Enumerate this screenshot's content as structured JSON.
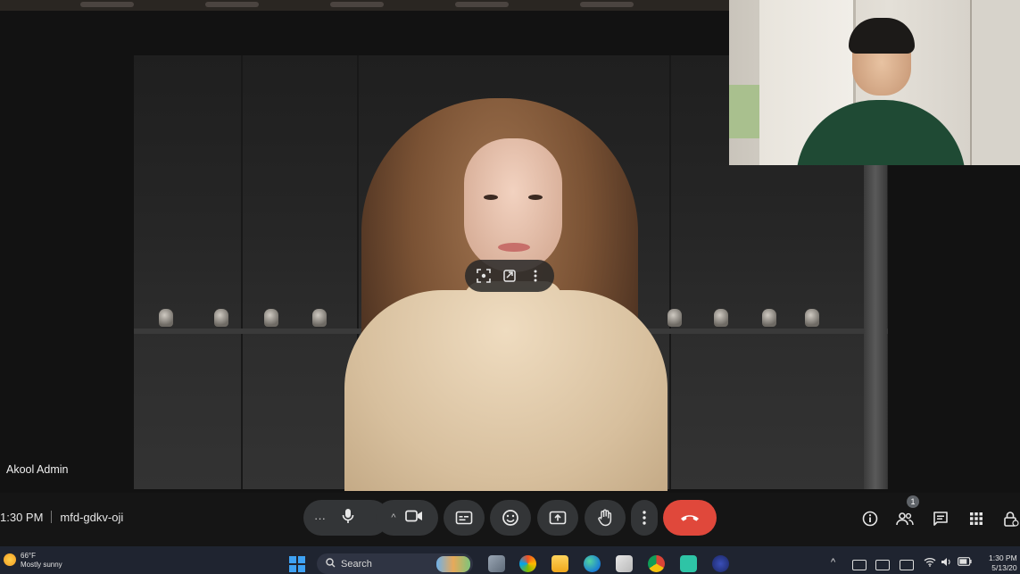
{
  "main_tile": {
    "participant_name": "Akool Admin"
  },
  "meeting": {
    "time": "1:30 PM",
    "code": "mfd-gdkv-oji"
  },
  "controls": {
    "more_options_glyph": "···",
    "mic_glyph": "🎙",
    "camera_chevron_glyph": "^",
    "camera_glyph": "▶",
    "captions_glyph": "CC",
    "emoji_glyph": "☺",
    "present_glyph": "⇪",
    "raise_hand_glyph": "✋",
    "overflow_glyph": "⋮",
    "end_call_glyph": "☎"
  },
  "right_panel": {
    "info_glyph": "ⓘ",
    "people_glyph": "👥",
    "people_count": "1",
    "chat_glyph": "💬",
    "activities_glyph": "⋮⋮",
    "host_controls_glyph": "🔒"
  },
  "taskbar": {
    "weather_temp": "66°F",
    "weather_desc": "Mostly sunny",
    "search_label": "Search",
    "tray_chevron_glyph": "^",
    "clock_time": "1:30 PM",
    "clock_date": "5/13/20"
  },
  "colors": {
    "end_call": "#e0483b",
    "control_bg": "#333537",
    "taskbar_bg": "#1f2430"
  }
}
